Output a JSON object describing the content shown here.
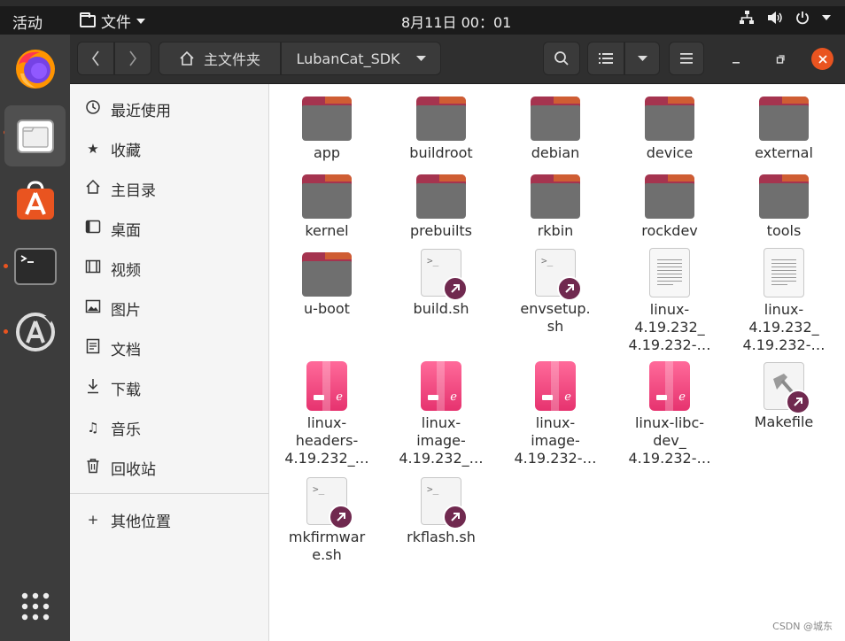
{
  "topbar": {
    "activities": "活动",
    "app_menu": "文件",
    "clock": "8月11日  00：01"
  },
  "dock": {
    "items": [
      "firefox-icon",
      "files-icon",
      "software-center-icon",
      "terminal-icon",
      "software-updater-icon"
    ],
    "show_apps_icon": "grid-icon"
  },
  "headerbar": {
    "home_label": "主文件夹",
    "current_folder": "LubanCat_SDK"
  },
  "sidebar": {
    "items": [
      {
        "label": "最近使用",
        "icon": "clock-icon"
      },
      {
        "label": "收藏",
        "icon": "star-icon"
      },
      {
        "label": "主目录",
        "icon": "home-icon"
      },
      {
        "label": "桌面",
        "icon": "desktop-icon"
      },
      {
        "label": "视频",
        "icon": "video-icon"
      },
      {
        "label": "图片",
        "icon": "image-icon"
      },
      {
        "label": "文档",
        "icon": "document-icon"
      },
      {
        "label": "下载",
        "icon": "download-icon"
      },
      {
        "label": "音乐",
        "icon": "music-icon"
      },
      {
        "label": "回收站",
        "icon": "trash-icon"
      }
    ],
    "other_locations": "其他位置"
  },
  "files": [
    {
      "name": "app",
      "type": "folder"
    },
    {
      "name": "buildroot",
      "type": "folder"
    },
    {
      "name": "debian",
      "type": "folder"
    },
    {
      "name": "device",
      "type": "folder"
    },
    {
      "name": "external",
      "type": "folder"
    },
    {
      "name": "kernel",
      "type": "folder"
    },
    {
      "name": "prebuilts",
      "type": "folder"
    },
    {
      "name": "rkbin",
      "type": "folder"
    },
    {
      "name": "rockdev",
      "type": "folder"
    },
    {
      "name": "tools",
      "type": "folder"
    },
    {
      "name": "u-boot",
      "type": "folder"
    },
    {
      "name": "build.sh",
      "type": "script-link"
    },
    {
      "name": "envsetup.\nsh",
      "type": "script-link"
    },
    {
      "name": "linux-\n4.19.232_\n4.19.232-…",
      "type": "text"
    },
    {
      "name": "linux-\n4.19.232_\n4.19.232-…",
      "type": "text"
    },
    {
      "name": "linux-\nheaders-\n4.19.232_…",
      "type": "deb"
    },
    {
      "name": "linux-\nimage-\n4.19.232_…",
      "type": "deb"
    },
    {
      "name": "linux-\nimage-\n4.19.232-…",
      "type": "deb"
    },
    {
      "name": "linux-libc-\ndev_\n4.19.232-…",
      "type": "deb"
    },
    {
      "name": "Makefile",
      "type": "make-link"
    },
    {
      "name": "mkfirmwar\ne.sh",
      "type": "script-link"
    },
    {
      "name": "rkflash.sh",
      "type": "script-link"
    }
  ],
  "watermark": "CSDN @城东"
}
